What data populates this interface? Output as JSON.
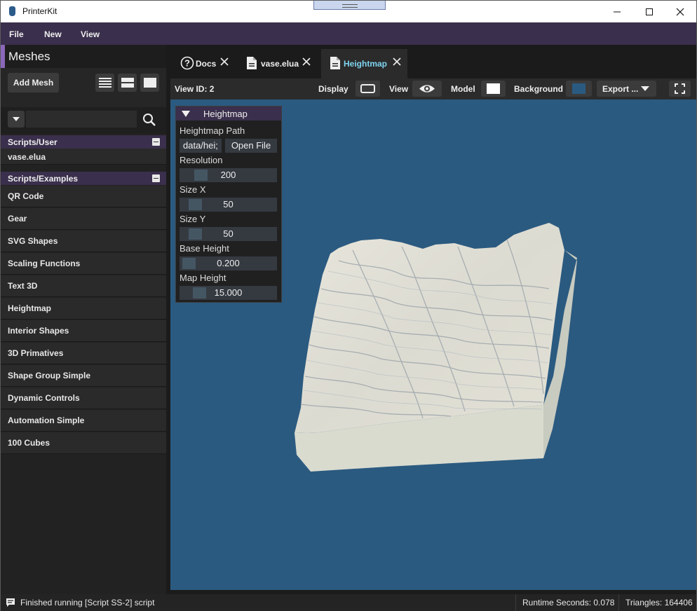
{
  "window": {
    "title": "PrinterKit",
    "icons": [
      "app-icon",
      "minimize-icon",
      "maximize-icon",
      "close-icon"
    ]
  },
  "menu": {
    "items": [
      "File",
      "New",
      "View"
    ]
  },
  "sidebar": {
    "title": "Meshes",
    "add_mesh_label": "Add Mesh",
    "view_mode_icons": [
      "list-view-icon",
      "split-view-icon",
      "single-view-icon"
    ],
    "search_value": "",
    "groups": [
      {
        "label": "Scripts/User",
        "items": [
          "vase.elua"
        ]
      },
      {
        "label": "Scripts/Examples",
        "items": [
          "QR Code",
          "Gear",
          "SVG Shapes",
          "Scaling Functions",
          "Text 3D",
          "Heightmap",
          "Interior Shapes",
          "3D Primatives",
          "Shape Group Simple",
          "Dynamic Controls",
          "Automation Simple",
          "100 Cubes"
        ]
      }
    ]
  },
  "tabs": [
    {
      "label": "Docs",
      "icon": "help-circle-icon",
      "active": false
    },
    {
      "label": "vase.elua",
      "icon": "document-icon",
      "active": false
    },
    {
      "label": "Heightmap",
      "icon": "document-icon",
      "active": true
    }
  ],
  "viewbar": {
    "view_id": "View ID: 2",
    "display_label": "Display",
    "view_label": "View",
    "model_label": "Model",
    "background_label": "Background",
    "export_label": "Export ...",
    "model_color": "#ffffff",
    "background_color": "#2b5a80"
  },
  "panel": {
    "title": "Heightmap",
    "path_label": "Heightmap Path",
    "path_value": "data/hei;",
    "open_file_label": "Open File",
    "resolution_label": "Resolution",
    "resolution_value": "200",
    "size_x_label": "Size X",
    "size_x_value": "50",
    "size_y_label": "Size Y",
    "size_y_value": "50",
    "base_height_label": "Base Height",
    "base_height_value": "0.200",
    "map_height_label": "Map Height",
    "map_height_value": "15.000"
  },
  "status": {
    "message": "Finished running [Script SS-2] script",
    "runtime": "Runtime Seconds: 0.078",
    "triangles": "Triangles: 164406"
  },
  "colors": {
    "accent_purple": "#3a2f4c",
    "active_tab_text": "#7fd4f0",
    "viewport_bg": "#2b5a80",
    "mesh_color": "#e6e4da"
  }
}
